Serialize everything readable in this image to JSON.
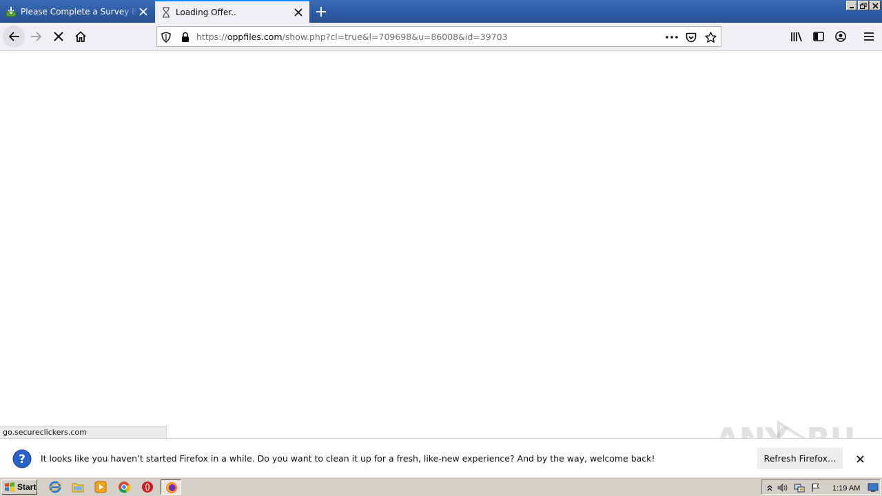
{
  "browser": {
    "tabs": [
      {
        "label": "Please Complete a Survey Below t",
        "icon": "download-box-icon",
        "active": false
      },
      {
        "label": "Loading Offer..",
        "icon": "hourglass-icon",
        "active": true
      }
    ],
    "url": {
      "prefix": "https://",
      "domain": "oppfiles.com",
      "path": "/show.php?cl=true&l=709698&u=86008&id=39703"
    }
  },
  "status_text": "go.secureclickers.com",
  "watermark": "ANY.RUN",
  "notification": {
    "message": "It looks like you haven’t started Firefox in a while. Do you want to clean it up for a fresh, like-new experience? And by the way, welcome back!",
    "button_label": "Refresh Firefox…"
  },
  "taskbar": {
    "start_label": "Start",
    "clock": "1:19 AM"
  },
  "colors": {
    "tab_accent": "#0a84ff",
    "titlebar": "#2d5aa4",
    "taskbar": "#d4d0c8"
  }
}
